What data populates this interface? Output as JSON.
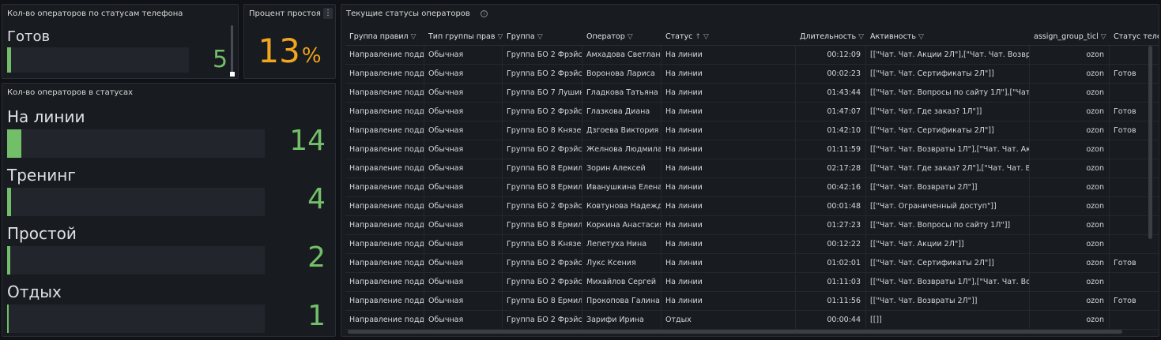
{
  "panel_phone": {
    "title": "Кол-во операторов по статусам телефона",
    "label": "Готов",
    "value": "5",
    "fill_fraction": 0.02
  },
  "panel_idle": {
    "title": "Процент простоя",
    "value": "13",
    "unit": "%",
    "color": "#f2a51e"
  },
  "panel_status": {
    "title": "Кол-во операторов в статусах",
    "items": [
      {
        "label": "На линии",
        "value": "14",
        "fill_fraction": 0.055
      },
      {
        "label": "Тренинг",
        "value": "4",
        "fill_fraction": 0.016
      },
      {
        "label": "Простой",
        "value": "2",
        "fill_fraction": 0.012
      },
      {
        "label": "Отдых",
        "value": "1",
        "fill_fraction": 0.006
      }
    ]
  },
  "panel_table": {
    "title": "Текущие статусы операторов",
    "info_icon": "info-icon",
    "columns": [
      "Группа правил",
      "Тип группы прав",
      "Группа",
      "Оператор",
      "Статус",
      "Длительность",
      "Активность",
      "assign_group_ticl",
      "Статус теле"
    ],
    "rows": [
      [
        "Направление подде",
        "Обычная",
        "Группа БО 2 Фрэйс Н",
        "Амхадова Светлана",
        "На линии",
        "00:12:09",
        "[[\"Чат. Чат. Акции 2Л\"],[\"Чат. Чат. Возвраты",
        "ozon",
        ""
      ],
      [
        "Направление подде",
        "Обычная",
        "Группа БО 2 Фрэйс Н",
        "Воронова Лариса",
        "На линии",
        "00:02:23",
        "[[\"Чат. Чат. Сертификаты 2Л\"]]",
        "ozon",
        "Готов"
      ],
      [
        "Направление подде",
        "Обычная",
        "Группа БО 7 Лушина",
        "Гладкова Татьяна",
        "На линии",
        "01:43:44",
        "[[\"Чат. Чат. Вопросы по сайту 1Л\"],[\"Чат. Ча",
        "ozon",
        ""
      ],
      [
        "Направление подде",
        "Обычная",
        "Группа БО 2 Фрэйс Н",
        "Глазкова Диана",
        "На линии",
        "01:47:07",
        "[[\"Чат. Чат. Где заказ? 1Л\"]]",
        "ozon",
        "Готов"
      ],
      [
        "Направление подде",
        "Обычная",
        "Группа БО 8 Князева",
        "Дзгоева Виктория",
        "На линии",
        "01:42:10",
        "[[\"Чат. Чат. Сертификаты 2Л\"]]",
        "ozon",
        "Готов"
      ],
      [
        "Направление подде",
        "Обычная",
        "Группа БО 2 Фрэйс Н",
        "Желнова Людмила",
        "На линии",
        "01:11:59",
        "[[\"Чат. Чат. Возвраты 1Л\"],[\"Чат. Чат. Акции",
        "ozon",
        ""
      ],
      [
        "Направление подде",
        "Обычная",
        "Группа БО 8 Ермило",
        "Зорин Алексей",
        "На линии",
        "02:17:28",
        "[[\"Чат. Чат. Где заказ? 2Л\"],[\"Чат. Чат. Возвр",
        "ozon",
        ""
      ],
      [
        "Направление подде",
        "Обычная",
        "Группа БО 8 Ермило",
        "Иванушкина Елена",
        "На линии",
        "00:42:16",
        "[[\"Чат. Чат. Возвраты 2Л\"]]",
        "ozon",
        ""
      ],
      [
        "Направление подде",
        "Обычная",
        "Группа БО 2 Фрэйс Н",
        "Ковтунова Надежда",
        "На линии",
        "00:01:48",
        "[[\"Чат. Ограниченный доступ\"]]",
        "ozon",
        ""
      ],
      [
        "Направление подде",
        "Обычная",
        "Группа БО 8 Ермило",
        "Коркина Анастасия",
        "На линии",
        "01:27:23",
        "[[\"Чат. Чат. Вопросы по сайту 1Л\"]]",
        "ozon",
        ""
      ],
      [
        "Направление подде",
        "Обычная",
        "Группа БО 8 Князева",
        "Лепетуха Нина",
        "На линии",
        "00:12:22",
        "[[\"Чат. Чат. Акции 2Л\"]]",
        "ozon",
        ""
      ],
      [
        "Направление подде",
        "Обычная",
        "Группа БО 2 Фрэйс Н",
        "Лукс Ксения",
        "На линии",
        "01:02:01",
        "[[\"Чат. Чат. Сертификаты 2Л\"]]",
        "ozon",
        "Готов"
      ],
      [
        "Направление подде",
        "Обычная",
        "Группа БО 2 Фрэйс Н",
        "Михайлов Сергей",
        "На линии",
        "01:11:03",
        "[[\"Чат. Чат. Возвраты 1Л\"],[\"Чат. Чат. Вопро",
        "ozon",
        ""
      ],
      [
        "Направление подде",
        "Обычная",
        "Группа БО 8 Ермило",
        "Прокопова Галина",
        "На линии",
        "01:11:56",
        "[[\"Чат. Чат. Возвраты 2Л\"]]",
        "ozon",
        "Готов"
      ],
      [
        "Направление подде",
        "Обычная",
        "Группа БО 2 Фрэйс Н",
        "Зарифи Ирина",
        "Отдых",
        "00:00:44",
        "[[]]",
        "ozon",
        ""
      ]
    ]
  }
}
